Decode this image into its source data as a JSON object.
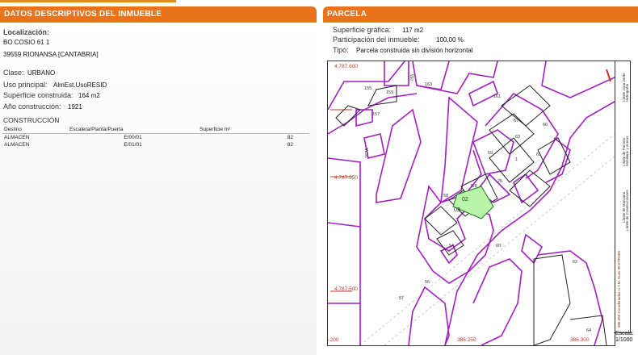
{
  "left": {
    "header": "DATOS DESCRIPTIVOS DEL INMUEBLE",
    "localizacion_label": "Localización:",
    "address_line1": "BO COSIO 61 1",
    "address_line2": "39559 RIONANSA [CANTABRIA]",
    "clase_label": "Clase:",
    "clase_value": "URBANO",
    "uso_label": "Uso principal:",
    "uso_value": "AlmEst.UsoRESID",
    "superficie_label": "Superficie construida:",
    "superficie_value": "164 m2",
    "anio_label": "Año construcción:",
    "anio_value": "1921",
    "construccion_title": "CONSTRUCCIÓN",
    "table": {
      "headers": [
        "Destino",
        "Escalera/Planta/Puerta",
        "Superficie m²"
      ],
      "rows": [
        [
          "ALMACEN",
          "E/00/01",
          "82"
        ],
        [
          "ALMACEN",
          "E/01/01",
          "82"
        ]
      ]
    }
  },
  "right": {
    "header": "PARCELA",
    "superficie_grafica_label": "Superficie gráfica:",
    "superficie_grafica_value": "117 m2",
    "participacion_label": "Participación del inmueble:",
    "participacion_value": "100,00 %",
    "tipo_label": "Tipo:",
    "tipo_value": "Parcela construida sin división horizontal",
    "map": {
      "coords": [
        "4.787.600",
        "4.787.550",
        "4.787.500",
        "386.200",
        "386.250",
        "386.300"
      ],
      "labels": [
        "155",
        "159",
        "161",
        "157",
        "165",
        "163",
        "157A",
        "61",
        "63",
        "59",
        "02",
        "03",
        "58",
        "54",
        "56",
        "57",
        "60",
        "62",
        "64",
        "67",
        "66",
        "1",
        "25"
      ],
      "legend": [
        "Límite de Manzana",
        "Límite de Parcela",
        "Límite de Construcciones",
        "Mobiliario y aceras",
        "Límite zona verde",
        "Hidrografía"
      ],
      "legend_side": "386.350 Coordenadas U.T.M. Huso 30 ETRS89",
      "escala_label": "Escala:",
      "escala_value": "1/1000",
      "colors": {
        "parcel": "#a020c0",
        "highlight": "#b9f5a8",
        "coord": "#c0392b"
      }
    }
  }
}
